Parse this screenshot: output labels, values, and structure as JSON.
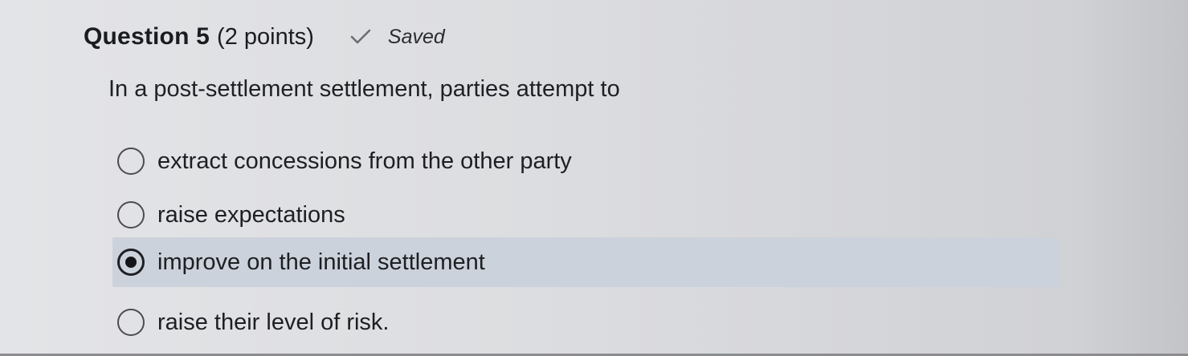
{
  "header": {
    "question_title": "Question 5",
    "points": "(2 points)",
    "status_icon": "checkmark-icon",
    "status_label": "Saved"
  },
  "question": {
    "prompt": "In a post-settlement settlement, parties attempt to"
  },
  "options": [
    {
      "label": "extract concessions from the other party",
      "selected": false
    },
    {
      "label": "raise expectations",
      "selected": false
    },
    {
      "label": "improve on the initial settlement",
      "selected": true
    },
    {
      "label": "raise their level of risk.",
      "selected": false
    }
  ],
  "colors": {
    "selected_row_bg": "#ccd2db",
    "text": "#1d1f22",
    "page_bg": "#dcdde0"
  }
}
